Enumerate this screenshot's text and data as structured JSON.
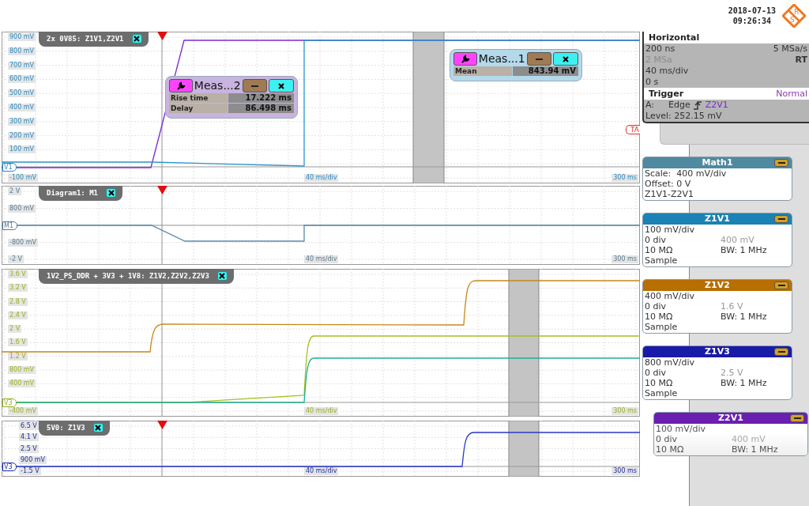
{
  "header": {
    "date": "2018-07-13",
    "time": "09:26:34",
    "logo_letters": [
      "R",
      "S"
    ]
  },
  "diagrams": [
    {
      "title": "2x 0V85: Z1V1,Z2V1",
      "marker": "V1",
      "y_labels": [
        "900 mV",
        "800 mV",
        "700 mV",
        "600 mV",
        "500 mV",
        "400 mV",
        "300 mV",
        "200 mV",
        "100 mV",
        "-100 mV"
      ],
      "x_labels": [
        "40 ms/div",
        "300 ms"
      ],
      "ref_marker": "TA"
    },
    {
      "title": "Diagram1: M1",
      "marker": "M1",
      "y_labels": [
        "2 V",
        "800 mV",
        "-800 mV",
        "-2 V"
      ],
      "x_labels": [
        "40 ms/div",
        "300 ms"
      ]
    },
    {
      "title": "1V2_PS_DDR + 3V3 + 1V8: Z1V2,Z2V2,Z2V3",
      "marker": "V3",
      "y_labels": [
        "3.6 V",
        "3.2 V",
        "2.8 V",
        "2.4 V",
        "2 V",
        "1.6 V",
        "1.2 V",
        "800 mV",
        "400 mV",
        "-400 mV"
      ],
      "x_labels": [
        "40 ms/div",
        "300 ms"
      ]
    },
    {
      "title": "5V0: Z1V3",
      "marker": "V3",
      "y_labels": [
        "6.5 V",
        "4.1 V",
        "2.5 V",
        "900 mV",
        "-1.5 V"
      ],
      "x_labels": [
        "40 ms/div",
        "300 ms"
      ]
    }
  ],
  "measurements": [
    {
      "title": "Meas...2",
      "color": "#c9b3df",
      "rows": [
        {
          "label": "Rise time",
          "value": "17.222 ms"
        },
        {
          "label": "Delay",
          "value": "86.498 ms"
        }
      ]
    },
    {
      "title": "Meas...1",
      "color": "#b3d9ea",
      "rows": [
        {
          "label": "Mean",
          "value": "843.94 mV"
        }
      ]
    }
  ],
  "horizontal": {
    "title": "Horizontal",
    "rows": [
      {
        "left": "200 ns",
        "right": "5 MSa/s",
        "dimmed": false,
        "right_bold": false
      },
      {
        "left": "2 MSa",
        "right": "RT",
        "dimmed": true,
        "right_bold": true
      },
      {
        "left": "40 ms/div",
        "dimmed": false
      },
      {
        "left": "0 s",
        "dimmed": false
      }
    ]
  },
  "trigger": {
    "title": "Trigger",
    "mode": "Normal",
    "event": "A:",
    "type": "Edge",
    "source": "Z2V1",
    "level_text": "Level: 252.15 mV"
  },
  "channels": [
    {
      "kind": "math",
      "name": "Math1",
      "color": "#4f8aa0",
      "faded": false,
      "lines": [
        "Scale:  400 mV/div",
        "Offset: 0 V",
        "Z1V1-Z2V1"
      ]
    },
    {
      "kind": "probe",
      "name": "Z1V1",
      "color": "#1a82b4",
      "faded": false,
      "scale": "100 mV/div",
      "offset": "0 div",
      "position": "400 mV",
      "impedance": "10 MΩ",
      "bandwidth": "BW: 1 MHz",
      "acquisition": "Sample"
    },
    {
      "kind": "probe",
      "name": "Z1V2",
      "color": "#b86e00",
      "faded": false,
      "scale": "400 mV/div",
      "offset": "0 div",
      "position": "1.6 V",
      "impedance": "10 MΩ",
      "bandwidth": "BW: 1 MHz",
      "acquisition": "Sample"
    },
    {
      "kind": "probe",
      "name": "Z1V3",
      "color": "#1a1aa8",
      "faded": false,
      "scale": "800 mV/div",
      "offset": "0 div",
      "position": "2.5 V",
      "impedance": "10 MΩ",
      "bandwidth": "BW: 1 MHz",
      "acquisition": "Sample"
    },
    {
      "kind": "probe",
      "name": "Z2V1",
      "color": "#6a1fb0",
      "faded": true,
      "scale": "100 mV/div",
      "offset": "0 div",
      "position": "400 mV",
      "impedance": "10 MΩ",
      "bandwidth": "BW: 1 MHz"
    }
  ]
}
